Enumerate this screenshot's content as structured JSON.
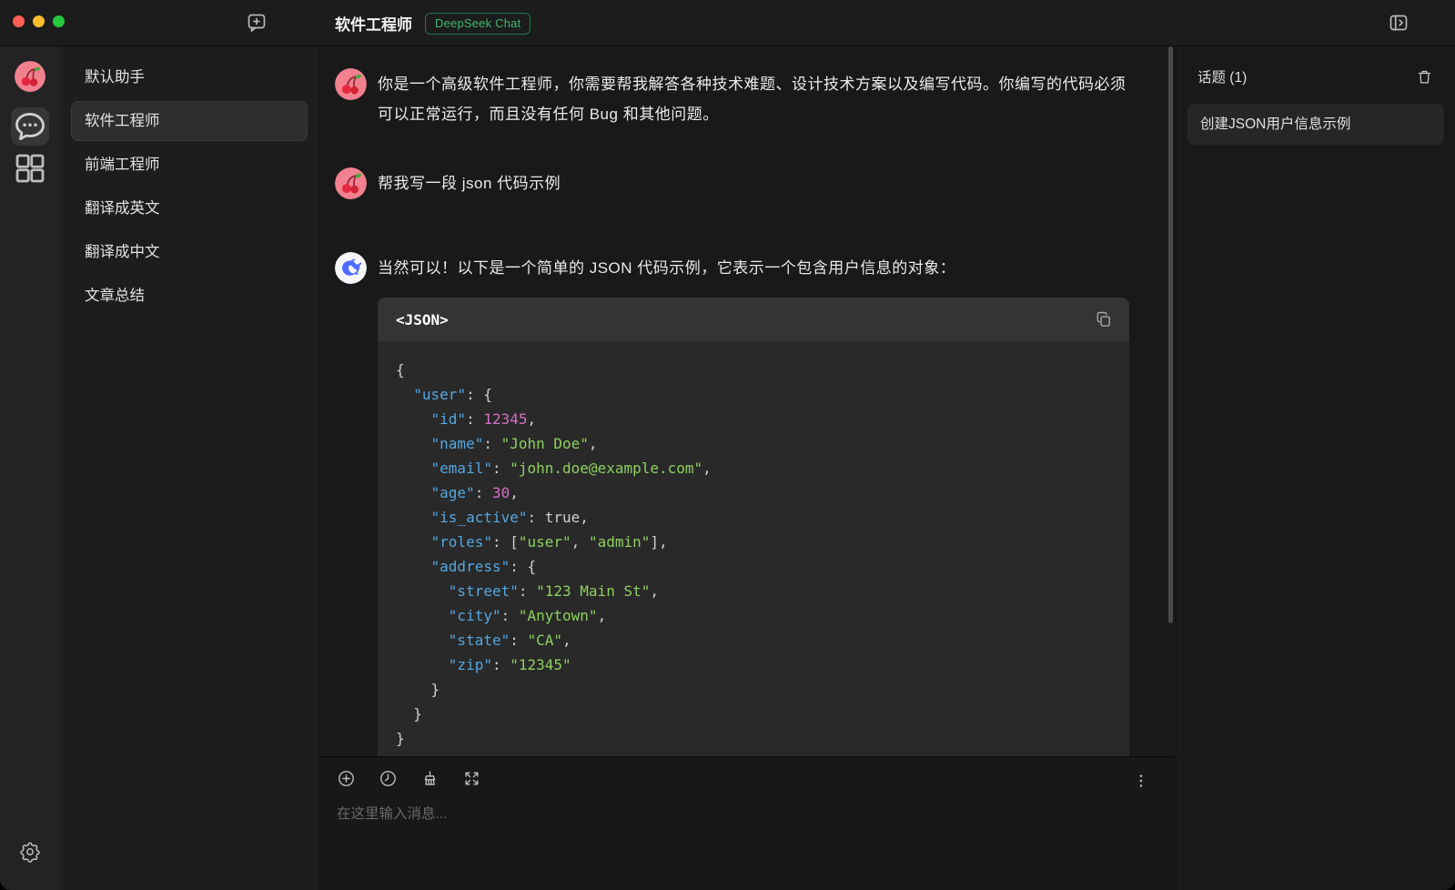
{
  "window": {
    "controls": [
      "close",
      "minimize",
      "zoom"
    ]
  },
  "topbar": {
    "title": "软件工程师",
    "model_badge": "DeepSeek Chat",
    "icons": [
      "new-topic-icon",
      "toggle-right-panel-icon"
    ]
  },
  "rail": {
    "icons": [
      "app-avatar-cherry",
      "chat-icon",
      "apps-grid-icon",
      "settings-gear-icon"
    ]
  },
  "sidebar": {
    "assistants": [
      {
        "label": "默认助手",
        "selected": false
      },
      {
        "label": "软件工程师",
        "selected": true
      },
      {
        "label": "前端工程师",
        "selected": false
      },
      {
        "label": "翻译成英文",
        "selected": false
      },
      {
        "label": "翻译成中文",
        "selected": false
      },
      {
        "label": "文章总结",
        "selected": false
      }
    ]
  },
  "chat": {
    "messages": [
      {
        "role": "user",
        "avatar": "cherry",
        "text": "你是一个高级软件工程师，你需要帮我解答各种技术难题、设计技术方案以及编写代码。你编写的代码必须可以正常运行，而且没有任何 Bug 和其他问题。"
      },
      {
        "role": "user",
        "avatar": "cherry",
        "text": "帮我写一段 json 代码示例"
      },
      {
        "role": "assistant",
        "avatar": "deepseek",
        "text": "当然可以！以下是一个简单的 JSON 代码示例，它表示一个包含用户信息的对象："
      }
    ]
  },
  "code_block": {
    "lang_label": "<JSON>",
    "copy_icon": "copy-icon",
    "lines": [
      [
        [
          "punc",
          "{"
        ]
      ],
      [
        [
          "punc",
          "  "
        ],
        [
          "key",
          "\"user\""
        ],
        [
          "punc",
          ": {"
        ]
      ],
      [
        [
          "punc",
          "    "
        ],
        [
          "key",
          "\"id\""
        ],
        [
          "punc",
          ": "
        ],
        [
          "num",
          "12345"
        ],
        [
          "punc",
          ","
        ]
      ],
      [
        [
          "punc",
          "    "
        ],
        [
          "key",
          "\"name\""
        ],
        [
          "punc",
          ": "
        ],
        [
          "str",
          "\"John Doe\""
        ],
        [
          "punc",
          ","
        ]
      ],
      [
        [
          "punc",
          "    "
        ],
        [
          "key",
          "\"email\""
        ],
        [
          "punc",
          ": "
        ],
        [
          "str",
          "\"john.doe@example.com\""
        ],
        [
          "punc",
          ","
        ]
      ],
      [
        [
          "punc",
          "    "
        ],
        [
          "key",
          "\"age\""
        ],
        [
          "punc",
          ": "
        ],
        [
          "num",
          "30"
        ],
        [
          "punc",
          ","
        ]
      ],
      [
        [
          "punc",
          "    "
        ],
        [
          "key",
          "\"is_active\""
        ],
        [
          "punc",
          ": "
        ],
        [
          "lit",
          "true"
        ],
        [
          "punc",
          ","
        ]
      ],
      [
        [
          "punc",
          "    "
        ],
        [
          "key",
          "\"roles\""
        ],
        [
          "punc",
          ": ["
        ],
        [
          "str",
          "\"user\""
        ],
        [
          "punc",
          ", "
        ],
        [
          "str",
          "\"admin\""
        ],
        [
          "punc",
          "],"
        ]
      ],
      [
        [
          "punc",
          "    "
        ],
        [
          "key",
          "\"address\""
        ],
        [
          "punc",
          ": {"
        ]
      ],
      [
        [
          "punc",
          "      "
        ],
        [
          "key",
          "\"street\""
        ],
        [
          "punc",
          ": "
        ],
        [
          "str",
          "\"123 Main St\""
        ],
        [
          "punc",
          ","
        ]
      ],
      [
        [
          "punc",
          "      "
        ],
        [
          "key",
          "\"city\""
        ],
        [
          "punc",
          ": "
        ],
        [
          "str",
          "\"Anytown\""
        ],
        [
          "punc",
          ","
        ]
      ],
      [
        [
          "punc",
          "      "
        ],
        [
          "key",
          "\"state\""
        ],
        [
          "punc",
          ": "
        ],
        [
          "str",
          "\"CA\""
        ],
        [
          "punc",
          ","
        ]
      ],
      [
        [
          "punc",
          "      "
        ],
        [
          "key",
          "\"zip\""
        ],
        [
          "punc",
          ": "
        ],
        [
          "str",
          "\"12345\""
        ]
      ],
      [
        [
          "punc",
          "    }"
        ]
      ],
      [
        [
          "punc",
          "  }"
        ]
      ],
      [
        [
          "punc",
          "}"
        ]
      ]
    ]
  },
  "input": {
    "placeholder": "在这里输入消息...",
    "icons": [
      "add-circle-icon",
      "history-clock-icon",
      "clear-context-broom-icon",
      "expand-icon",
      "more-kebab-icon"
    ]
  },
  "topics": {
    "header": "话题 (1)",
    "trash_icon": "trash-icon",
    "items": [
      "创建JSON用户信息示例"
    ]
  },
  "colors": {
    "badge_green": "#3cba6e",
    "code_key_blue": "#55a7e0",
    "code_string_green": "#8ed05f",
    "code_number_pink": "#d46fc7",
    "deepseek_blue": "#4d6bfe",
    "cherry_pink": "#f2808f",
    "traffic_red": "#ff5f57",
    "traffic_yellow": "#febc2e",
    "traffic_green": "#28c840"
  }
}
